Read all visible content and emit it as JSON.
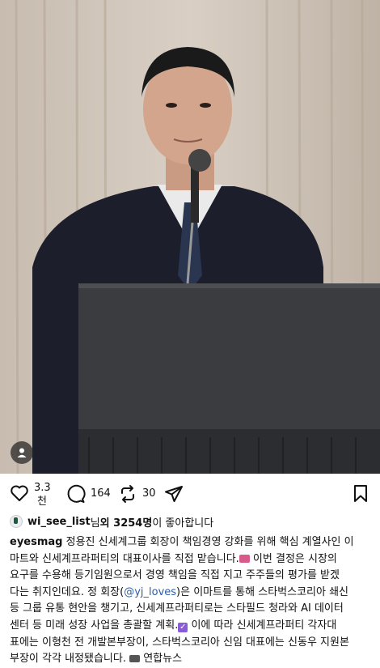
{
  "post": {
    "image_alt": "Man in dark suit speaking at a podium with a microphone",
    "like_count_line1": "3.3",
    "like_count_line2": "천",
    "comment_count": "164",
    "repost_count": "30"
  },
  "likes": {
    "user": "wi_see_list",
    "suffix1": "님 ",
    "others": "외 3254명",
    "suffix2": "이 좋아합니다"
  },
  "caption": {
    "author": "eyesmag",
    "l1": " 정용진 신세계그룹 회장이 책임경영 강화를 위해 핵심 계열사인 이",
    "l2a": "마트와 신세계프라퍼티의 대표이사를 직접 맡습니다.",
    "l2b": " 이번 결정은 시장의",
    "l3": "요구를 수용해 등기임원으로서 경영 책임을 직접 지고 주주들의 평가를 받겠",
    "l4a": "다는 취지인데요. 정 회장(",
    "l4mention": "@yj_loves",
    "l4b": ")은 이마트를 통해 스타벅스코리아 쇄신",
    "l5": "등 그룹 유통 현안을 챙기고, 신세계프라퍼티로는 스타필드 청라와 AI 데이터",
    "l6a": "센터 등 미래 성장 사업을 총괄할 계획.",
    "l6b": " 이에 따라 신세계프라퍼티 각자대",
    "l7": "표에는 이형천 전 개발본부장이, 스타벅스코리아 신임 대표에는 신동우 지원본",
    "l8a": "부장이 각각 내정됐습니다. ",
    "l8b": " 연합뉴스"
  },
  "icons": {
    "like": "heart-icon",
    "comment": "comment-icon",
    "repost": "repost-icon",
    "share": "send-icon",
    "save": "bookmark-icon",
    "tag": "user-tag-icon"
  }
}
